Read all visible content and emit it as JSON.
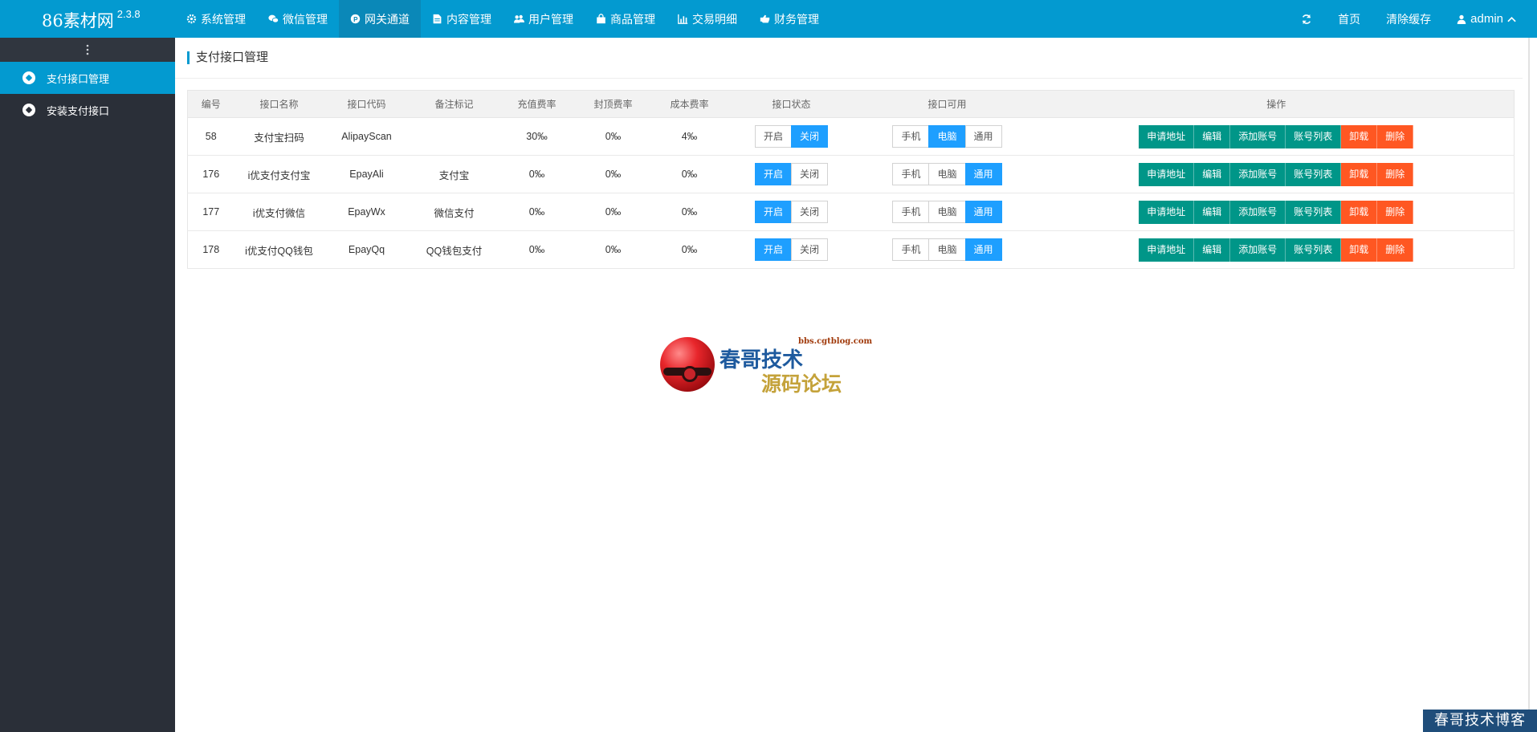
{
  "header": {
    "brand": "86素材网",
    "version": "2.3.8",
    "nav": [
      {
        "label": "系统管理",
        "icon": "gear-icon"
      },
      {
        "label": "微信管理",
        "icon": "wechat-icon"
      },
      {
        "label": "网关通道",
        "icon": "gateway-icon"
      },
      {
        "label": "内容管理",
        "icon": "document-icon"
      },
      {
        "label": "用户管理",
        "icon": "users-icon"
      },
      {
        "label": "商品管理",
        "icon": "shopping-bag-icon"
      },
      {
        "label": "交易明细",
        "icon": "bar-chart-icon"
      },
      {
        "label": "财务管理",
        "icon": "finance-icon"
      }
    ],
    "active_nav": "网关通道",
    "right": {
      "refresh_icon": "refresh-icon",
      "home": "首页",
      "clear_cache": "清除缓存",
      "user": "admin"
    }
  },
  "sidebar": {
    "toggle_icon": "vertical-dots-icon",
    "items": [
      {
        "label": "支付接口管理",
        "icon": "soccer-ball-icon",
        "active": true
      },
      {
        "label": "安装支付接口",
        "icon": "soccer-ball-icon",
        "active": false
      }
    ]
  },
  "page": {
    "title": "支付接口管理"
  },
  "table": {
    "columns": [
      "编号",
      "接口名称",
      "接口代码",
      "备注标记",
      "充值费率",
      "封顶费率",
      "成本费率",
      "接口状态",
      "接口可用",
      "操作"
    ],
    "rows": [
      {
        "id": "58",
        "name": "支付宝扫码",
        "code": "AlipayScan",
        "remark": "",
        "rate": "30‰",
        "cap": "0‰",
        "cost": "4‰",
        "status": "关闭",
        "avail": "电脑"
      },
      {
        "id": "176",
        "name": "i优支付支付宝",
        "code": "EpayAli",
        "remark": "支付宝",
        "rate": "0‰",
        "cap": "0‰",
        "cost": "0‰",
        "status": "开启",
        "avail": "通用"
      },
      {
        "id": "177",
        "name": "i优支付微信",
        "code": "EpayWx",
        "remark": "微信支付",
        "rate": "0‰",
        "cap": "0‰",
        "cost": "0‰",
        "status": "开启",
        "avail": "通用"
      },
      {
        "id": "178",
        "name": "i优支付QQ钱包",
        "code": "EpayQq",
        "remark": "QQ钱包支付",
        "rate": "0‰",
        "cap": "0‰",
        "cost": "0‰",
        "status": "开启",
        "avail": "通用"
      }
    ],
    "status_options": [
      "开启",
      "关闭"
    ],
    "avail_options": [
      "手机",
      "电脑",
      "通用"
    ],
    "actions": [
      "申请地址",
      "编辑",
      "添加账号",
      "账号列表",
      "卸载",
      "删除"
    ]
  },
  "watermark": {
    "line1": "春哥技术",
    "url": "bbs.cgtblog.com",
    "line2": "源码论坛",
    "corner": "春哥技术博客"
  },
  "colors": {
    "header_bg": "#039ad0",
    "sidebar_bg": "#2a2f38",
    "toggle_on": "#1e9fff",
    "action_green": "#009688",
    "action_orange": "#ff5722"
  }
}
